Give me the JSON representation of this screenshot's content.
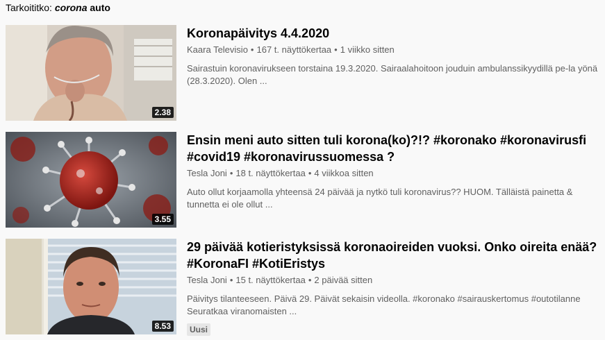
{
  "correction": {
    "prefix": "Tarkoititko:",
    "query_italic": "corona",
    "query_rest": " auto"
  },
  "results": [
    {
      "title": "Koronapäivitys 4.4.2020",
      "channel": "Kaara Televisio",
      "views": "167 t. näyttökertaa",
      "age": "1 viikko sitten",
      "description": "Sairastuin koronavirukseen torstaina 19.3.2020. Sairaalahoitoon jouduin ambulanssikyydillä pe-la yönä (28.3.2020). Olen ...",
      "duration": "2.38",
      "badge": ""
    },
    {
      "title": "Ensin meni auto sitten tuli korona(ko)?!? #koronako #koronavirusfi #covid19 #koronavirussuomessa ?",
      "channel": "Tesla Joni",
      "views": "18 t. näyttökertaa",
      "age": "4 viikkoa sitten",
      "description": "Auto ollut korjaamolla yhteensä 24 päivää ja nytkö tuli koronavirus?? HUOM. Tälläistä painetta & tunnetta ei ole ollut ...",
      "duration": "3.55",
      "badge": ""
    },
    {
      "title": "29 päivää kotieristyksissä koronaoireiden vuoksi. Onko oireita enää? #KoronaFI #KotiEristys",
      "channel": "Tesla Joni",
      "views": "15 t. näyttökertaa",
      "age": "2 päivää sitten",
      "description": "Päivitys tilanteeseen. Päivä 29. Päivät sekaisin videolla. #koronako #sairauskertomus #outotilanne Seuratkaa viranomaisten ...",
      "duration": "8.53",
      "badge": "Uusi"
    }
  ],
  "colors": {
    "background": "#f9f9f9",
    "title": "#030303",
    "meta": "#606060",
    "virus_red": "#b3261e"
  }
}
